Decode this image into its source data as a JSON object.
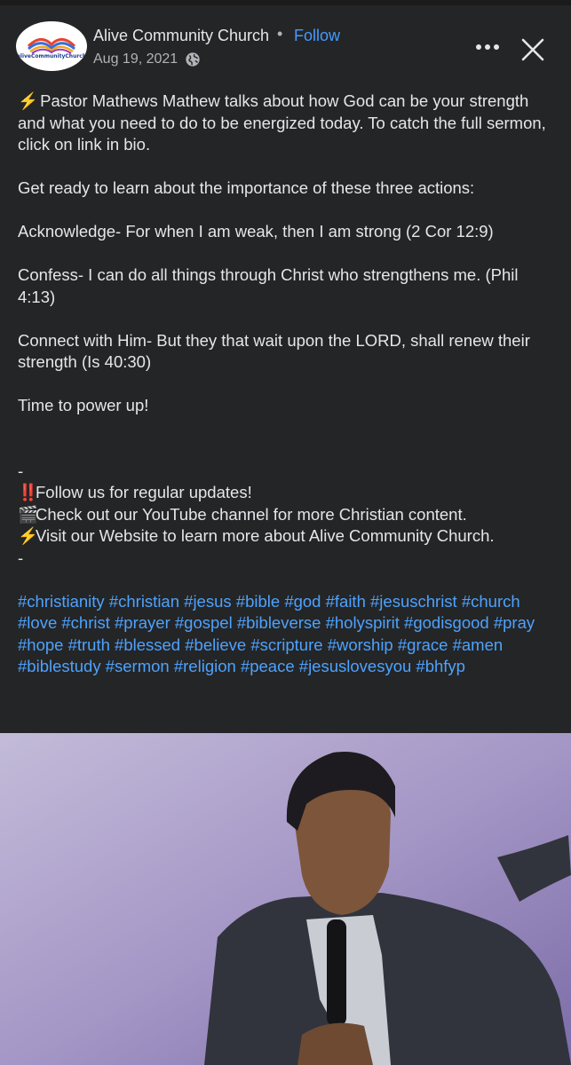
{
  "header": {
    "page_name": "Alive Community Church",
    "separator": "•",
    "follow_label": "Follow",
    "date": "Aug 19, 2021",
    "logo_text": "aliveCommunityChurch"
  },
  "icons": {
    "globe": "globe-icon",
    "more": "more-options-icon",
    "close": "close-icon",
    "lightning": "⚡",
    "exclamation": "‼️",
    "clapper": "🎬"
  },
  "post": {
    "line1": "Pastor Mathews Mathew talks about how God can be your strength and what you need to do to be energized today. To catch the full sermon, click on  link in bio.",
    "line2": "Get ready to learn about the importance of these three actions:",
    "line3": "Acknowledge- For when I am weak, then I am strong (2 Cor 12:9)",
    "line4": "Confess- I can do all things through Christ who strengthens me. (Phil 4:13)",
    "line5": "Connect with Him- But they that wait upon the LORD, shall renew their strength (Is 40:30)",
    "line6": "Time to power up!",
    "dash1": "-",
    "follow_line": "Follow us for regular updates!",
    "youtube_line": "Check out  our YouTube channel for more Christian content.",
    "website_line": "Visit our Website to learn more about Alive Community Church.",
    "dash2": "-"
  },
  "hashtags": [
    "#christianity",
    "#christian",
    "#jesus",
    "#bible",
    "#god",
    "#faith",
    "#jesuschrist",
    "#church",
    "#love",
    "#christ",
    "#prayer",
    "#gospel",
    "#bibleverse",
    "#holyspirit",
    "#godisgood",
    "#pray",
    "#hope",
    "#truth",
    "#blessed",
    "#believe",
    "#scripture",
    "#worship",
    "#grace",
    "#amen",
    "#biblestudy",
    "#sermon",
    "#religion",
    "#peace",
    "#jesuslovesyou",
    "#bhfyp"
  ],
  "colors": {
    "background": "#242526",
    "text": "#e4e6eb",
    "secondary_text": "#b0b3b8",
    "link": "#4599ff",
    "hashtag": "#4da2ff"
  }
}
